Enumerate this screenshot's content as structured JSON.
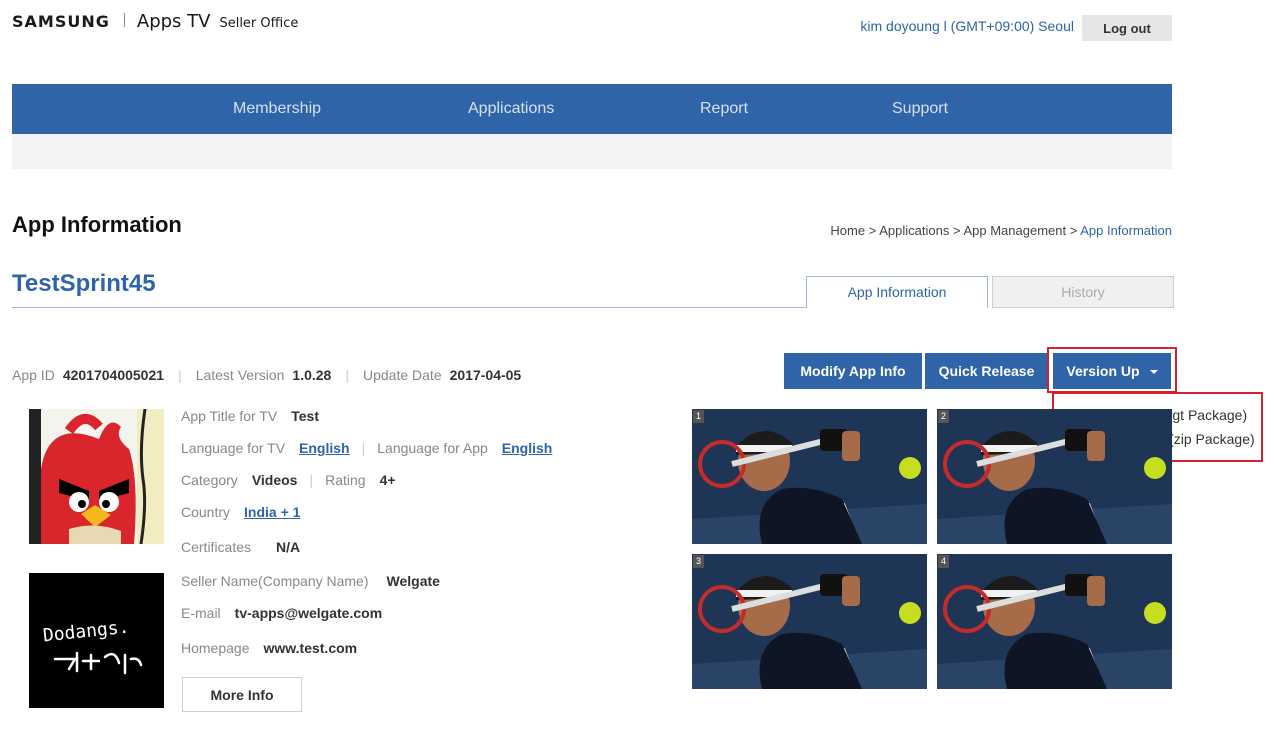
{
  "header": {
    "logo_samsung": "SAMSUNG",
    "logo_apps_tv": "Apps TV",
    "logo_seller_office": "Seller Office",
    "user_info": "kim doyoung l (GMT+09:00) Seoul",
    "logout_label": "Log out"
  },
  "nav": {
    "items": [
      {
        "label": "Membership"
      },
      {
        "label": "Applications"
      },
      {
        "label": "Report"
      },
      {
        "label": "Support"
      }
    ]
  },
  "page": {
    "title": "App Information",
    "breadcrumb": {
      "items": [
        "Home",
        "Applications",
        "App Management"
      ],
      "separator": ">",
      "current": "App Information"
    }
  },
  "app": {
    "name": "TestSprint45",
    "tabs": [
      {
        "label": "App Information",
        "active": true
      },
      {
        "label": "History",
        "active": false
      }
    ],
    "meta": {
      "app_id_label": "App ID",
      "app_id": "4201704005021",
      "latest_version_label": "Latest Version",
      "latest_version": "1.0.28",
      "update_date_label": "Update Date",
      "update_date": "2017-04-05"
    },
    "actions": {
      "modify_label": "Modify App Info",
      "quick_release_label": "Quick Release",
      "version_up_label": "Version Up",
      "version_up_options": [
        "Tizen Platform (wgt Package)",
        "Legacy Platform (zip Package)"
      ]
    },
    "details": {
      "app_title_label": "App Title for TV",
      "app_title": "Test",
      "lang_tv_label": "Language for TV",
      "lang_tv": "English",
      "lang_app_label": "Language for App",
      "lang_app": "English",
      "category_label": "Category",
      "category": "Videos",
      "rating_label": "Rating",
      "rating": "4+",
      "country_label": "Country",
      "country": "India + 1",
      "certificates_label": "Certificates",
      "certificates": "N/A"
    },
    "seller": {
      "name_label": "Seller Name(Company Name)",
      "name": "Welgate",
      "email_label": "E-mail",
      "email": "tv-apps@welgate.com",
      "homepage_label": "Homepage",
      "homepage": "www.test.com",
      "logo_text": "Dodangs."
    },
    "more_info_label": "More Info",
    "screenshots": [
      {
        "number": "1"
      },
      {
        "number": "2"
      },
      {
        "number": "3"
      },
      {
        "number": "4"
      }
    ]
  },
  "colors": {
    "primary": "#2f64a9",
    "highlight": "#d6202c"
  }
}
